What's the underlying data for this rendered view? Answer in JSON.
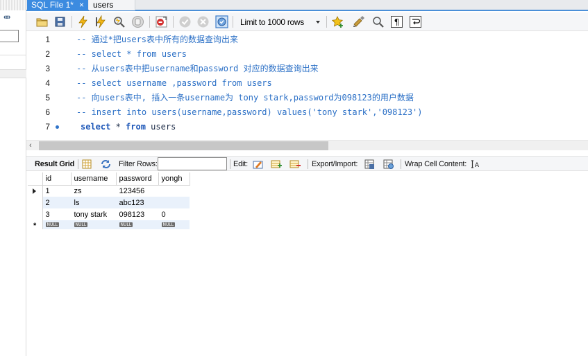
{
  "tabs": [
    {
      "label": "SQL File 1*",
      "close": "×",
      "active": true
    },
    {
      "label": "users",
      "active": false
    }
  ],
  "toolbar": {
    "limit_label": "Limit to 1000 rows",
    "icons": [
      "open-folder-icon",
      "save-icon",
      "execute-lightning-icon",
      "execute-cursor-lightning-icon",
      "explain-magnifier-icon",
      "stop-icon",
      "toggle-error-icon",
      "commit-icon",
      "rollback-icon",
      "autocommit-icon",
      "add-snippet-star-icon",
      "beautify-brush-icon",
      "find-icon",
      "invisible-chars-icon",
      "wrap-lines-icon"
    ]
  },
  "editor": {
    "lines": [
      {
        "num": "1",
        "text": "-- 通过*把users表中所有的数据查询出来",
        "type": "comment"
      },
      {
        "num": "2",
        "text": "-- select * from users",
        "type": "comment"
      },
      {
        "num": "3",
        "text": "-- 从users表中把username和password 对应的数据查询出来",
        "type": "comment"
      },
      {
        "num": "4",
        "text": "-- select username ,password from users",
        "type": "comment"
      },
      {
        "num": "5",
        "text": "-- 向users表中, 插入一条username为 tony stark,password为098123的用户数据",
        "type": "comment"
      },
      {
        "num": "6",
        "text": "-- insert into users(username,password) values('tony stark','098123')",
        "type": "comment"
      },
      {
        "num": "7",
        "kw1": "select",
        "mid": " * ",
        "kw2": "from",
        "tail": " users",
        "type": "code"
      }
    ]
  },
  "result_toolbar": {
    "result_grid": "Result Grid",
    "filter_rows": "Filter Rows:",
    "filter_value": "",
    "edit": "Edit:",
    "export_import": "Export/Import:",
    "wrap_cell": "Wrap Cell Content:"
  },
  "grid": {
    "columns": [
      "id",
      "username",
      "password",
      "yongh"
    ],
    "rows": [
      {
        "id": "1",
        "username": "zs",
        "password": "123456",
        "yongh": ""
      },
      {
        "id": "2",
        "username": "ls",
        "password": "abc123",
        "yongh": ""
      },
      {
        "id": "3",
        "username": "tony stark",
        "password": "098123",
        "yongh": "0"
      }
    ],
    "null_label": "NULL",
    "new_row_marker": "*"
  },
  "colors": {
    "tab_active": "#3c8be0",
    "comment": "#2a6fc6",
    "keyword": "#1d57b8",
    "row_alt": "#e9f1fb"
  }
}
